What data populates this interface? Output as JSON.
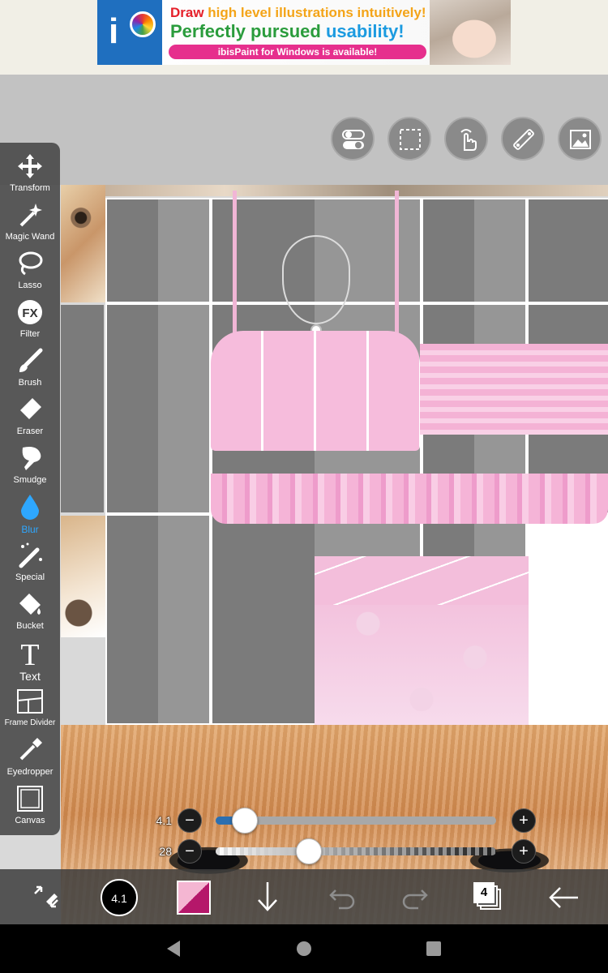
{
  "ad": {
    "line1_a": "Draw ",
    "line1_b": "high level illustrations intuitively!",
    "line2_a": "Perfectly pursued ",
    "line2_b": "usability!",
    "line3": "ibisPaint for Windows is available!",
    "logo_text": "i"
  },
  "top_buttons": [
    {
      "name": "toggle-icon"
    },
    {
      "name": "selection-icon"
    },
    {
      "name": "touch-icon"
    },
    {
      "name": "ruler-icon"
    },
    {
      "name": "image-icon"
    }
  ],
  "tools": [
    {
      "label": "Transform",
      "icon": "move-icon"
    },
    {
      "label": "Magic Wand",
      "icon": "magic-wand-icon"
    },
    {
      "label": "Lasso",
      "icon": "lasso-icon"
    },
    {
      "label": "Filter",
      "icon": "fx-icon",
      "glyph": "FX"
    },
    {
      "label": "Brush",
      "icon": "brush-icon"
    },
    {
      "label": "Eraser",
      "icon": "eraser-icon"
    },
    {
      "label": "Smudge",
      "icon": "smudge-icon"
    },
    {
      "label": "Blur",
      "icon": "blur-drop-icon",
      "active": true
    },
    {
      "label": "Special",
      "icon": "special-pen-icon"
    },
    {
      "label": "Bucket",
      "icon": "bucket-icon"
    },
    {
      "label": "Text",
      "icon": "text-icon",
      "glyph": "T"
    },
    {
      "label": "Frame Divider",
      "icon": "frame-divider-icon"
    },
    {
      "label": "Eyedropper",
      "icon": "eyedropper-icon"
    },
    {
      "label": "Canvas",
      "icon": "canvas-icon"
    }
  ],
  "sliders": {
    "size": {
      "value": "4.1",
      "fraction": 0.07
    },
    "opacity": {
      "value": "28",
      "fraction": 0.28
    }
  },
  "bottom": {
    "brush_size": "4.1",
    "layers_count": "4"
  },
  "colors": {
    "accent": "#2ea7ff",
    "foreground": "#b5176a",
    "background_swatch": "#f4b6d2",
    "toolbar": "#464646"
  }
}
